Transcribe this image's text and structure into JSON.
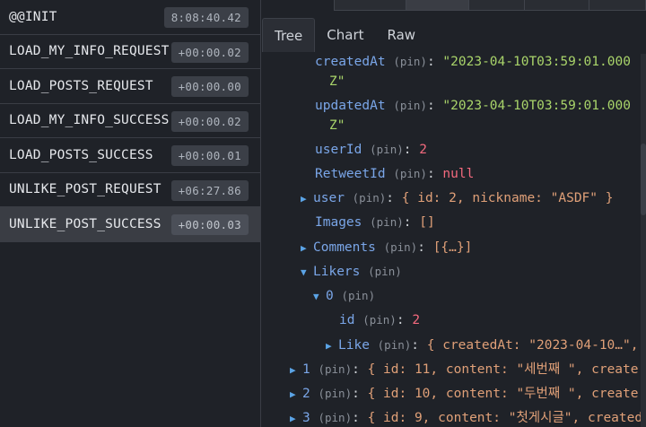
{
  "actions": [
    {
      "name": "@@INIT",
      "time": "8:08:40.42"
    },
    {
      "name": "LOAD_MY_INFO_REQUEST",
      "time": "+00:00.02"
    },
    {
      "name": "LOAD_POSTS_REQUEST",
      "time": "+00:00.00"
    },
    {
      "name": "LOAD_MY_INFO_SUCCESS",
      "time": "+00:00.02"
    },
    {
      "name": "LOAD_POSTS_SUCCESS",
      "time": "+00:00.01"
    },
    {
      "name": "UNLIKE_POST_REQUEST",
      "time": "+06:27.86"
    },
    {
      "name": "UNLIKE_POST_SUCCESS",
      "time": "+00:00.03"
    }
  ],
  "tabs": [
    "Tree",
    "Chart",
    "Raw"
  ],
  "pin": "(pin)",
  "tree": {
    "createdAt_key": "createdAt",
    "createdAt_val1": "\"2023-04-10T03:59:01.000",
    "createdAt_val2": "Z\"",
    "updatedAt_key": "updatedAt",
    "updatedAt_val1": "\"2023-04-10T03:59:01.000",
    "updatedAt_val2": "Z\"",
    "userId_key": "userId",
    "userId_val": "2",
    "retweet_key": "RetweetId",
    "retweet_val": "null",
    "user_key": "user",
    "user_val": "{ id: 2, nickname: \"ASDF\" }",
    "images_key": "Images",
    "images_val": "[]",
    "comments_key": "Comments",
    "comments_val": "[{…}]",
    "likers_key": "Likers",
    "zero_key": "0",
    "id_key": "id",
    "id_val": "2",
    "like_key": "Like",
    "like_val": "{ createdAt: \"2023-04-10…\",",
    "row1_key": "1",
    "row1_val": "{ id: 11, content: \"세번째 \", create",
    "row2_key": "2",
    "row2_val": "{ id: 10, content: \"두번째 \", create",
    "row3_key": "3",
    "row3_val": "{ id: 9, content: \"첫게시글\", created"
  }
}
